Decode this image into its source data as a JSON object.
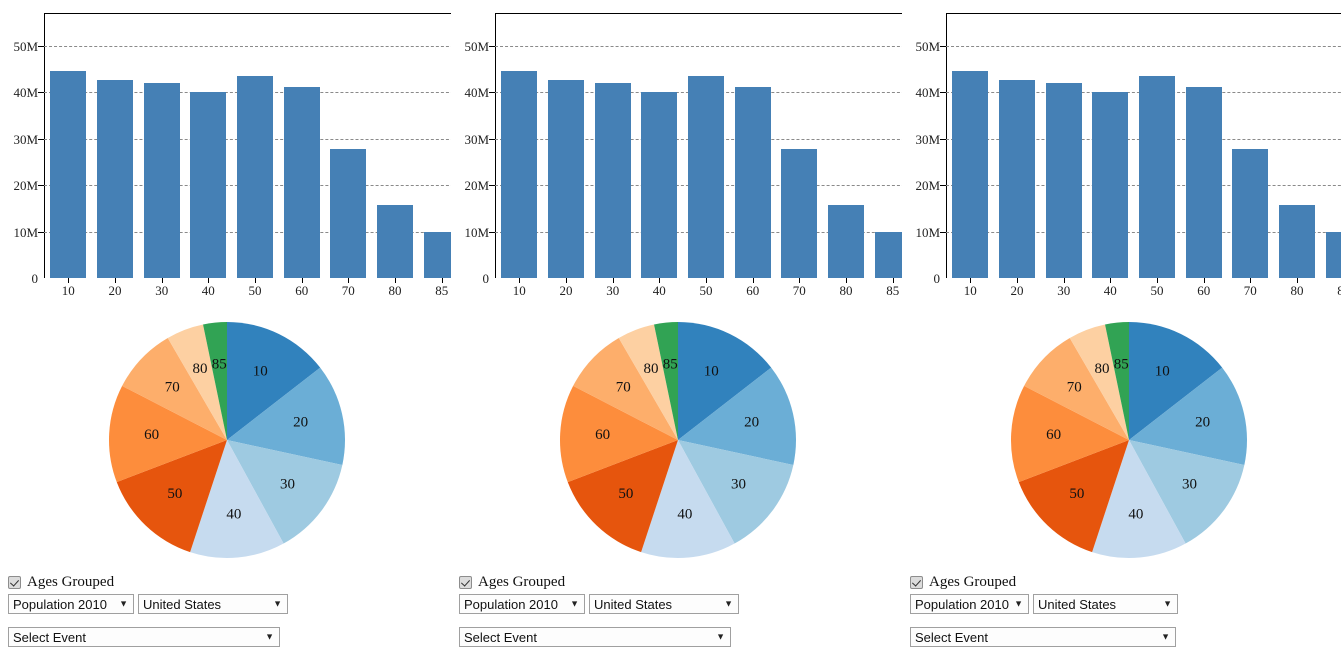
{
  "chart_data": [
    {
      "type": "bar",
      "title": "",
      "xlabel": "",
      "ylabel": "",
      "categories": [
        "10",
        "20",
        "30",
        "40",
        "50",
        "60",
        "70",
        "80",
        "85"
      ],
      "values": [
        44500000,
        42700000,
        41900000,
        40000000,
        43400000,
        41100000,
        27800000,
        15700000,
        10000000
      ],
      "ylim": [
        0,
        57000000
      ],
      "ytick_labels": [
        "0",
        "10M",
        "20M",
        "30M",
        "40M",
        "50M"
      ],
      "ytick_values": [
        0,
        10000000,
        20000000,
        30000000,
        40000000,
        50000000
      ],
      "grid": true,
      "legend": "none",
      "bar_color": "#4580b5"
    },
    {
      "type": "pie",
      "title": "",
      "categories": [
        "10",
        "20",
        "30",
        "40",
        "50",
        "60",
        "70",
        "80",
        "85"
      ],
      "values": [
        44500000,
        42700000,
        41900000,
        40000000,
        43400000,
        41100000,
        27800000,
        15700000,
        10000000
      ],
      "colors": [
        "#3182bd",
        "#6baed6",
        "#9ecae1",
        "#c6dbef",
        "#e6550d",
        "#fd8d3c",
        "#fdae6b",
        "#fdd0a2",
        "#31a354"
      ],
      "legend": "none",
      "labels_inside": true
    }
  ],
  "panels": [
    {
      "id": "panel-1",
      "controls": {
        "checkbox_label": "Ages Grouped",
        "checkbox_checked": true,
        "dataset_value": "Population 2010",
        "geography_value": "United States",
        "event_value": "Select Event"
      }
    },
    {
      "id": "panel-2",
      "controls": {
        "checkbox_label": "Ages Grouped",
        "checkbox_checked": true,
        "dataset_value": "Population 2010",
        "geography_value": "United States",
        "event_value": "Select Event"
      }
    },
    {
      "id": "panel-3",
      "controls": {
        "checkbox_label": "Ages Grouped",
        "checkbox_checked": true,
        "dataset_value": "Population 2010",
        "geography_value": "United States",
        "event_value": "Select Event"
      }
    }
  ],
  "icons": {
    "dropdown_arrow": "▼",
    "checkmark": "✔"
  }
}
